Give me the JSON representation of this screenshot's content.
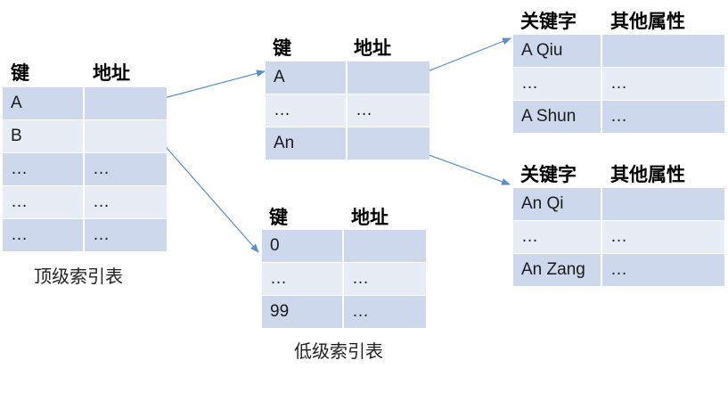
{
  "top_table": {
    "headers": [
      "键",
      "地址"
    ],
    "rows": [
      [
        "A",
        ""
      ],
      [
        "B",
        ""
      ],
      [
        "…",
        "…"
      ],
      [
        "…",
        "…"
      ],
      [
        "…",
        "…"
      ]
    ],
    "caption": "顶级索引表"
  },
  "mid_table": {
    "headers": [
      "键",
      "地址"
    ],
    "rows": [
      [
        "A",
        ""
      ],
      [
        "…",
        "…"
      ],
      [
        "An",
        ""
      ]
    ]
  },
  "low_table": {
    "headers": [
      "键",
      "地址"
    ],
    "rows": [
      [
        "0",
        ""
      ],
      [
        "…",
        "…"
      ],
      [
        "99",
        "…"
      ]
    ],
    "caption": "低级索引表"
  },
  "record_table_1": {
    "headers": [
      "关键字",
      "其他属性"
    ],
    "rows": [
      [
        "A Qiu",
        ""
      ],
      [
        "…",
        "…"
      ],
      [
        "A Shun",
        "…"
      ]
    ]
  },
  "record_table_2": {
    "headers": [
      "关键字",
      "其他属性"
    ],
    "rows": [
      [
        "An Qi",
        ""
      ],
      [
        "…",
        "…"
      ],
      [
        "An Zang",
        "…"
      ]
    ]
  },
  "colors": {
    "row_dark": "#cdd8ec",
    "row_light": "#e8edf5",
    "arrow": "#5b8fc9"
  }
}
